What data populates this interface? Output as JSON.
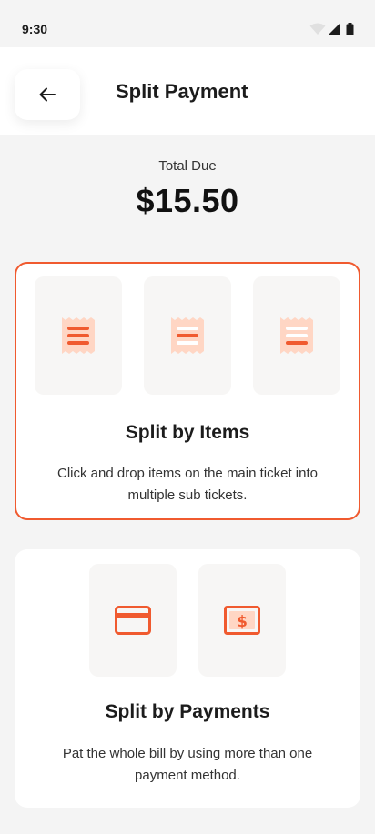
{
  "status_bar": {
    "time": "9:30"
  },
  "header": {
    "title": "Split Payment"
  },
  "total": {
    "label": "Total Due",
    "amount": "$15.50"
  },
  "options": [
    {
      "title": "Split by Items",
      "description": "Click and drop items on the main ticket into multiple sub tickets.",
      "selected": true,
      "icons": [
        "receipt-three-lines-icon",
        "receipt-one-line-icon",
        "receipt-two-lines-icon"
      ]
    },
    {
      "title": "Split by Payments",
      "description": "Pat the whole bill by using more than one payment method.",
      "selected": false,
      "icons": [
        "credit-card-icon",
        "cash-dollar-icon"
      ]
    }
  ],
  "colors": {
    "accent": "#f05a2f",
    "accent_light": "#ffd6c4",
    "background": "#f4f4f4",
    "card": "#ffffff",
    "thumb": "#f7f6f5"
  }
}
